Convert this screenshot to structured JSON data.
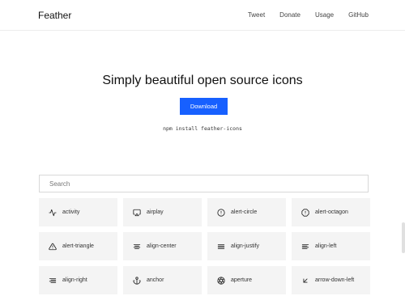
{
  "header": {
    "logo": "Feather",
    "nav": [
      "Tweet",
      "Donate",
      "Usage",
      "GitHub"
    ]
  },
  "hero": {
    "title": "Simply beautiful open source icons",
    "download_label": "Download",
    "npm_command": "npm install feather-icons"
  },
  "search": {
    "placeholder": "Search",
    "value": ""
  },
  "icons": [
    {
      "name": "activity",
      "icon": "activity-icon"
    },
    {
      "name": "airplay",
      "icon": "airplay-icon"
    },
    {
      "name": "alert-circle",
      "icon": "alert-circle-icon"
    },
    {
      "name": "alert-octagon",
      "icon": "alert-octagon-icon"
    },
    {
      "name": "alert-triangle",
      "icon": "alert-triangle-icon"
    },
    {
      "name": "align-center",
      "icon": "align-center-icon"
    },
    {
      "name": "align-justify",
      "icon": "align-justify-icon"
    },
    {
      "name": "align-left",
      "icon": "align-left-icon"
    },
    {
      "name": "align-right",
      "icon": "align-right-icon"
    },
    {
      "name": "anchor",
      "icon": "anchor-icon"
    },
    {
      "name": "aperture",
      "icon": "aperture-icon"
    },
    {
      "name": "arrow-down-left",
      "icon": "arrow-down-left-icon"
    }
  ],
  "colors": {
    "accent": "#1760ff",
    "tile_bg": "#f4f4f4"
  }
}
